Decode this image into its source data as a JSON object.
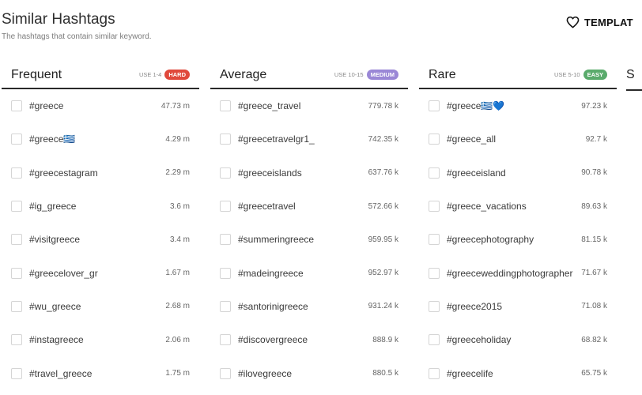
{
  "header": {
    "title": "Similar Hashtags",
    "subtitle": "The hashtags that contain similar keyword.",
    "template_label": "TEMPLAT"
  },
  "colors": {
    "hard": "#e0493c",
    "medium": "#9a87d6",
    "easy": "#5aab6c"
  },
  "icons": {
    "template": "heart-icon"
  },
  "columns": [
    {
      "name": "Frequent",
      "use": "USE 1-4",
      "badge": "HARD",
      "rows": [
        {
          "tag": "#greece",
          "count": "47.73 m"
        },
        {
          "tag": "#greece🇬🇷",
          "count": "4.29 m"
        },
        {
          "tag": "#greecestagram",
          "count": "2.29 m"
        },
        {
          "tag": "#ig_greece",
          "count": "3.6 m"
        },
        {
          "tag": "#visitgreece",
          "count": "3.4 m"
        },
        {
          "tag": "#greecelover_gr",
          "count": "1.67 m"
        },
        {
          "tag": "#wu_greece",
          "count": "2.68 m"
        },
        {
          "tag": "#instagreece",
          "count": "2.06 m"
        },
        {
          "tag": "#travel_greece",
          "count": "1.75 m"
        }
      ]
    },
    {
      "name": "Average",
      "use": "USE 10-15",
      "badge": "MEDIUM",
      "rows": [
        {
          "tag": "#greece_travel",
          "count": "779.78 k"
        },
        {
          "tag": "#greecetravelgr1_",
          "count": "742.35 k"
        },
        {
          "tag": "#greeceislands",
          "count": "637.76 k"
        },
        {
          "tag": "#greecetravel",
          "count": "572.66 k"
        },
        {
          "tag": "#summeringreece",
          "count": "959.95 k"
        },
        {
          "tag": "#madeingreece",
          "count": "952.97 k"
        },
        {
          "tag": "#santorinigreece",
          "count": "931.24 k"
        },
        {
          "tag": "#discovergreece",
          "count": "888.9 k"
        },
        {
          "tag": "#ilovegreece",
          "count": "880.5 k"
        }
      ]
    },
    {
      "name": "Rare",
      "use": "USE 5-10",
      "badge": "EASY",
      "rows": [
        {
          "tag": "#greece🇬🇷💙",
          "count": "97.23 k"
        },
        {
          "tag": "#greece_all",
          "count": "92.7 k"
        },
        {
          "tag": "#greeceisland",
          "count": "90.78 k"
        },
        {
          "tag": "#greece_vacations",
          "count": "89.63 k"
        },
        {
          "tag": "#greecephotography",
          "count": "81.15 k"
        },
        {
          "tag": "#greeceweddingphotographer",
          "count": "71.67 k"
        },
        {
          "tag": "#greece2015",
          "count": "71.08 k"
        },
        {
          "tag": "#greeceholiday",
          "count": "68.82 k"
        },
        {
          "tag": "#greecelife",
          "count": "65.75 k"
        }
      ]
    }
  ],
  "fourth_column_partial_label": "S"
}
